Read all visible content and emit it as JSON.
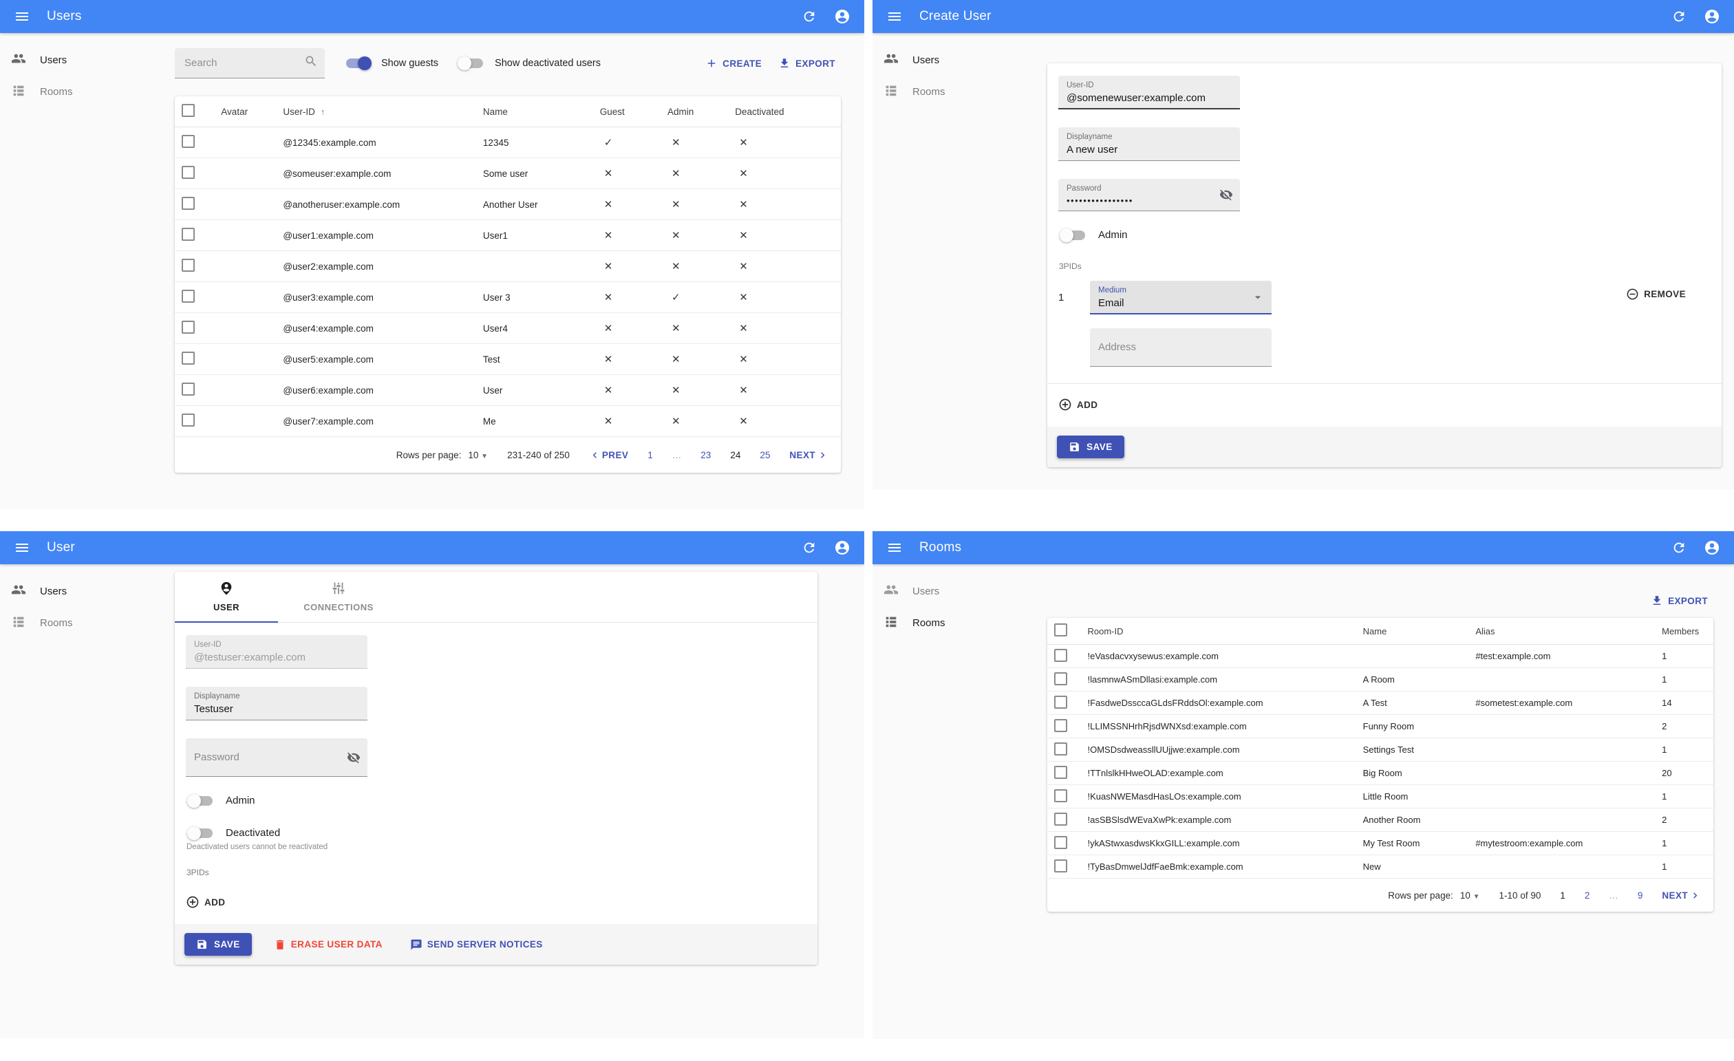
{
  "colors": {
    "appbar_blue": "#4285f4",
    "primary_indigo": "#3f51b5",
    "danger_red": "#f44336",
    "page_background": "#fafafa"
  },
  "panels": {
    "users_list": {
      "appbar_title": "Users",
      "sidebar": {
        "items": [
          {
            "label": "Users",
            "active": true
          },
          {
            "label": "Rooms",
            "active": false
          }
        ]
      },
      "toolbar": {
        "search_placeholder": "Search",
        "show_guests_label": "Show guests",
        "show_guests_on": true,
        "show_deactivated_label": "Show deactivated users",
        "show_deactivated_on": false,
        "create_label": "CREATE",
        "export_label": "EXPORT"
      },
      "table": {
        "headers": {
          "avatar": "Avatar",
          "user_id": "User-ID",
          "name": "Name",
          "guest": "Guest",
          "admin": "Admin",
          "deactivated": "Deactivated"
        },
        "rows": [
          {
            "id": "@12345:example.com",
            "name": "12345",
            "guest": "check",
            "admin": "cross",
            "deactivated": "cross"
          },
          {
            "id": "@someuser:example.com",
            "name": "Some user",
            "guest": "cross",
            "admin": "cross",
            "deactivated": "cross"
          },
          {
            "id": "@anotheruser:example.com",
            "name": "Another User",
            "guest": "cross",
            "admin": "cross",
            "deactivated": "cross"
          },
          {
            "id": "@user1:example.com",
            "name": "User1",
            "guest": "cross",
            "admin": "cross",
            "deactivated": "cross"
          },
          {
            "id": "@user2:example.com",
            "name": "",
            "guest": "cross",
            "admin": "cross",
            "deactivated": "cross"
          },
          {
            "id": "@user3:example.com",
            "name": "User 3",
            "guest": "cross",
            "admin": "check",
            "deactivated": "cross"
          },
          {
            "id": "@user4:example.com",
            "name": "User4",
            "guest": "cross",
            "admin": "cross",
            "deactivated": "cross"
          },
          {
            "id": "@user5:example.com",
            "name": "Test",
            "guest": "cross",
            "admin": "cross",
            "deactivated": "cross"
          },
          {
            "id": "@user6:example.com",
            "name": "User",
            "guest": "cross",
            "admin": "cross",
            "deactivated": "cross"
          },
          {
            "id": "@user7:example.com",
            "name": "Me",
            "guest": "cross",
            "admin": "cross",
            "deactivated": "cross"
          }
        ]
      },
      "pagination": {
        "rows_per_page_label": "Rows per page:",
        "rows_per_page": "10",
        "range": "231-240 of 250",
        "prev_label": "PREV",
        "next_label": "NEXT",
        "pages": [
          {
            "label": "1",
            "type": "link"
          },
          {
            "label": "…",
            "type": "ellipsis"
          },
          {
            "label": "23",
            "type": "link"
          },
          {
            "label": "24",
            "type": "current"
          },
          {
            "label": "25",
            "type": "link"
          }
        ]
      }
    },
    "create_user": {
      "appbar_title": "Create User",
      "sidebar": {
        "items": [
          {
            "label": "Users",
            "active": true
          },
          {
            "label": "Rooms",
            "active": false
          }
        ]
      },
      "fields": {
        "user_id": {
          "label": "User-ID",
          "value": "@somenewuser:example.com"
        },
        "displayname": {
          "label": "Displayname",
          "value": "A new user"
        },
        "password": {
          "label": "Password",
          "masked_value": "••••••••••••••••"
        },
        "admin_label": "Admin",
        "admin_on": false,
        "pids_label": "3PIDs",
        "pid_index": "1",
        "medium": {
          "label": "Medium",
          "value": "Email"
        },
        "remove_label": "REMOVE",
        "address_placeholder": "Address",
        "add_label": "ADD"
      },
      "toolbar": {
        "save_label": "SAVE"
      }
    },
    "user_detail": {
      "appbar_title": "User",
      "sidebar": {
        "items": [
          {
            "label": "Users",
            "active": true
          },
          {
            "label": "Rooms",
            "active": false
          }
        ]
      },
      "tabs": [
        {
          "label": "USER",
          "active": true
        },
        {
          "label": "CONNECTIONS",
          "active": false
        }
      ],
      "fields": {
        "user_id": {
          "label": "User-ID",
          "value": "@testuser:example.com"
        },
        "displayname": {
          "label": "Displayname",
          "value": "Testuser"
        },
        "password_placeholder": "Password",
        "admin_label": "Admin",
        "admin_on": false,
        "deactivated_label": "Deactivated",
        "deactivated_on": false,
        "deactivated_helper": "Deactivated users cannot be reactivated",
        "pids_label": "3PIDs",
        "add_label": "ADD"
      },
      "toolbar": {
        "save_label": "SAVE",
        "erase_label": "ERASE USER DATA",
        "notices_label": "SEND SERVER NOTICES"
      }
    },
    "rooms_list": {
      "appbar_title": "Rooms",
      "sidebar": {
        "items": [
          {
            "label": "Users",
            "active": false
          },
          {
            "label": "Rooms",
            "active": true
          }
        ]
      },
      "toolbar": {
        "export_label": "EXPORT"
      },
      "table": {
        "headers": {
          "room_id": "Room-ID",
          "name": "Name",
          "alias": "Alias",
          "members": "Members"
        },
        "rows": [
          {
            "id": "!eVasdacvxysewus:example.com",
            "name": "",
            "alias": "#test:example.com",
            "members": "1"
          },
          {
            "id": "!lasmnwASmDllasi:example.com",
            "name": "A Room",
            "alias": "",
            "members": "1"
          },
          {
            "id": "!FasdweDssccaGLdsFRddsOl:example.com",
            "name": "A Test",
            "alias": "#sometest:example.com",
            "members": "14"
          },
          {
            "id": "!LLIMSSNHrhRjsdWNXsd:example.com",
            "name": "Funny Room",
            "alias": "",
            "members": "2"
          },
          {
            "id": "!OMSDsdweassllUUjjwe:example.com",
            "name": "Settings Test",
            "alias": "",
            "members": "1"
          },
          {
            "id": "!TTnlslkHHweOLAD:example.com",
            "name": "Big Room",
            "alias": "",
            "members": "20"
          },
          {
            "id": "!KuasNWEMasdHasLOs:example.com",
            "name": "Little Room",
            "alias": "",
            "members": "1"
          },
          {
            "id": "!asSBSlsdWEvaXwPk:example.com",
            "name": "Another Room",
            "alias": "",
            "members": "2"
          },
          {
            "id": "!ykAStwxasdwsKkxGILL:example.com",
            "name": "My Test Room",
            "alias": "#mytestroom:example.com",
            "members": "1"
          },
          {
            "id": "!TyBasDmwelJdfFaeBmk:example.com",
            "name": "New",
            "alias": "",
            "members": "1"
          }
        ]
      },
      "pagination": {
        "rows_per_page_label": "Rows per page:",
        "rows_per_page": "10",
        "range": "1-10 of 90",
        "next_label": "NEXT",
        "pages": [
          {
            "label": "1",
            "type": "current"
          },
          {
            "label": "2",
            "type": "link"
          },
          {
            "label": "…",
            "type": "ellipsis"
          },
          {
            "label": "9",
            "type": "link"
          }
        ]
      }
    }
  }
}
